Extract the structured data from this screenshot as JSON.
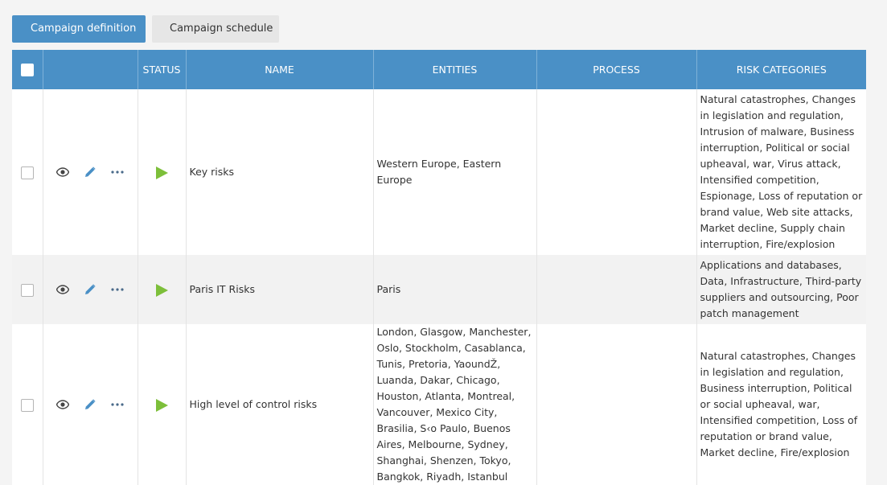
{
  "tabs": [
    {
      "label": "Campaign definition"
    },
    {
      "label": "Campaign schedule"
    }
  ],
  "table": {
    "headers": {
      "status": "STATUS",
      "name": "NAME",
      "entities": "ENTITIES",
      "process": "PROCESS",
      "risk_categories": "RISK CATEGORIES"
    },
    "rows": [
      {
        "status": "running",
        "name": "Key risks",
        "entities": "Western Europe, Eastern Europe",
        "process": "",
        "risk_categories": "Natural catastrophes, Changes in legislation and regulation, Intrusion of malware, Business interruption, Political or social upheaval, war, Virus attack, Intensified competition, Espionage, Loss of reputation or brand value, Web site attacks, Market decline, Supply chain interruption, Fire/explosion"
      },
      {
        "status": "running",
        "name": "Paris IT Risks",
        "entities": "Paris",
        "process": "",
        "risk_categories": "Applications and databases, Data, Infrastructure, Third-party suppliers and outsourcing, Poor patch management"
      },
      {
        "status": "running",
        "name": "High level of control risks",
        "entities": "London, Glasgow, Manchester, Oslo, Stockholm, Casablanca, Tunis, Pretoria, YaoundŽ, Luanda, Dakar, Chicago, Houston, Atlanta, Montreal, Vancouver, Mexico City, Brasilia, S‹o Paulo, Buenos Aires, Melbourne, Sydney, Shanghai, Shenzen, Tokyo, Bangkok, Riyadh, Istanbul",
        "process": "",
        "risk_categories": "Natural catastrophes, Changes in legislation and regulation, Business interruption, Political or social upheaval, war, Intensified competition, Loss of reputation or brand value, Market decline, Fire/explosion"
      }
    ]
  },
  "icons": {
    "view": "eye-icon",
    "edit": "pencil-icon",
    "more": "more-dots-icon",
    "status": "play-icon"
  },
  "colors": {
    "accent": "#4a90c6",
    "status_running": "#7dbf3a",
    "edit_icon": "#4a90c6"
  }
}
